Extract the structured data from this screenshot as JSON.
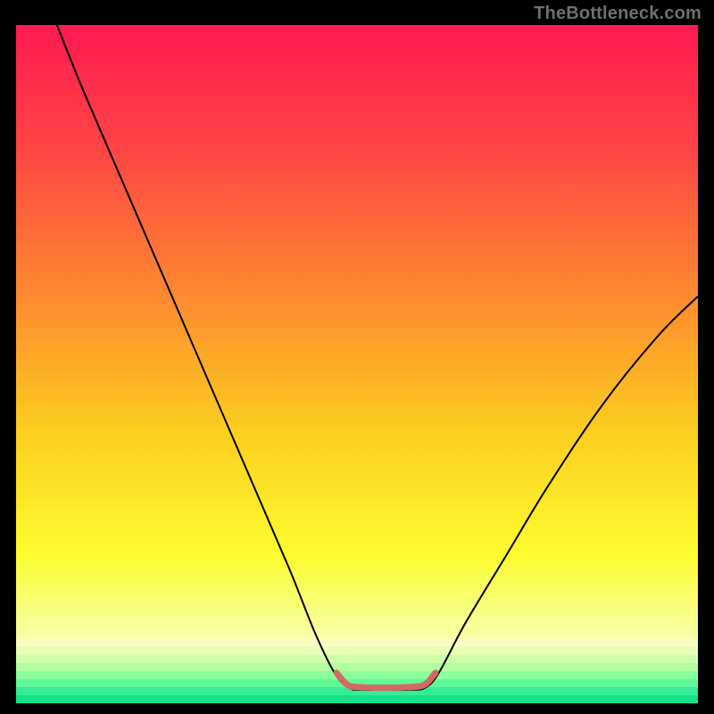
{
  "watermark": "TheBottleneck.com",
  "chart_data": {
    "type": "line",
    "title": "",
    "xlabel": "",
    "ylabel": "",
    "xlim": [
      0,
      100
    ],
    "ylim": [
      0,
      100
    ],
    "background_gradient": {
      "stops": [
        {
          "offset": 0,
          "color": "#ff1a52"
        },
        {
          "offset": 0.18,
          "color": "#ff4444"
        },
        {
          "offset": 0.4,
          "color": "#fe8a2f"
        },
        {
          "offset": 0.6,
          "color": "#fbce1f"
        },
        {
          "offset": 0.78,
          "color": "#fdfc2e"
        },
        {
          "offset": 0.87,
          "color": "#f8ff87"
        },
        {
          "offset": 0.92,
          "color": "#f4ffb9"
        },
        {
          "offset": 0.955,
          "color": "#c7ffb3"
        },
        {
          "offset": 0.975,
          "color": "#7fffa0"
        },
        {
          "offset": 1.0,
          "color": "#15e08c"
        }
      ]
    },
    "series": [
      {
        "name": "bottleneck-curve",
        "color": "#000000",
        "width": 2,
        "points": [
          {
            "x": 6,
            "y": 100
          },
          {
            "x": 10,
            "y": 90
          },
          {
            "x": 16,
            "y": 76
          },
          {
            "x": 22,
            "y": 62
          },
          {
            "x": 28,
            "y": 48
          },
          {
            "x": 34,
            "y": 34
          },
          {
            "x": 40,
            "y": 20
          },
          {
            "x": 44,
            "y": 10
          },
          {
            "x": 47,
            "y": 4
          },
          {
            "x": 49,
            "y": 2.3
          },
          {
            "x": 50,
            "y": 2
          },
          {
            "x": 55,
            "y": 2
          },
          {
            "x": 58,
            "y": 2
          },
          {
            "x": 60,
            "y": 2.3
          },
          {
            "x": 62,
            "y": 4.5
          },
          {
            "x": 66,
            "y": 12
          },
          {
            "x": 72,
            "y": 22
          },
          {
            "x": 78,
            "y": 32
          },
          {
            "x": 86,
            "y": 44
          },
          {
            "x": 94,
            "y": 54
          },
          {
            "x": 100,
            "y": 60
          }
        ]
      },
      {
        "name": "valley-highlight",
        "color": "#d36a62",
        "width": 7,
        "points": [
          {
            "x": 47,
            "y": 4.5
          },
          {
            "x": 48.5,
            "y": 2.8
          },
          {
            "x": 50,
            "y": 2.4
          },
          {
            "x": 54,
            "y": 2.3
          },
          {
            "x": 58,
            "y": 2.4
          },
          {
            "x": 60,
            "y": 2.8
          },
          {
            "x": 61.5,
            "y": 4.5
          }
        ]
      }
    ]
  }
}
